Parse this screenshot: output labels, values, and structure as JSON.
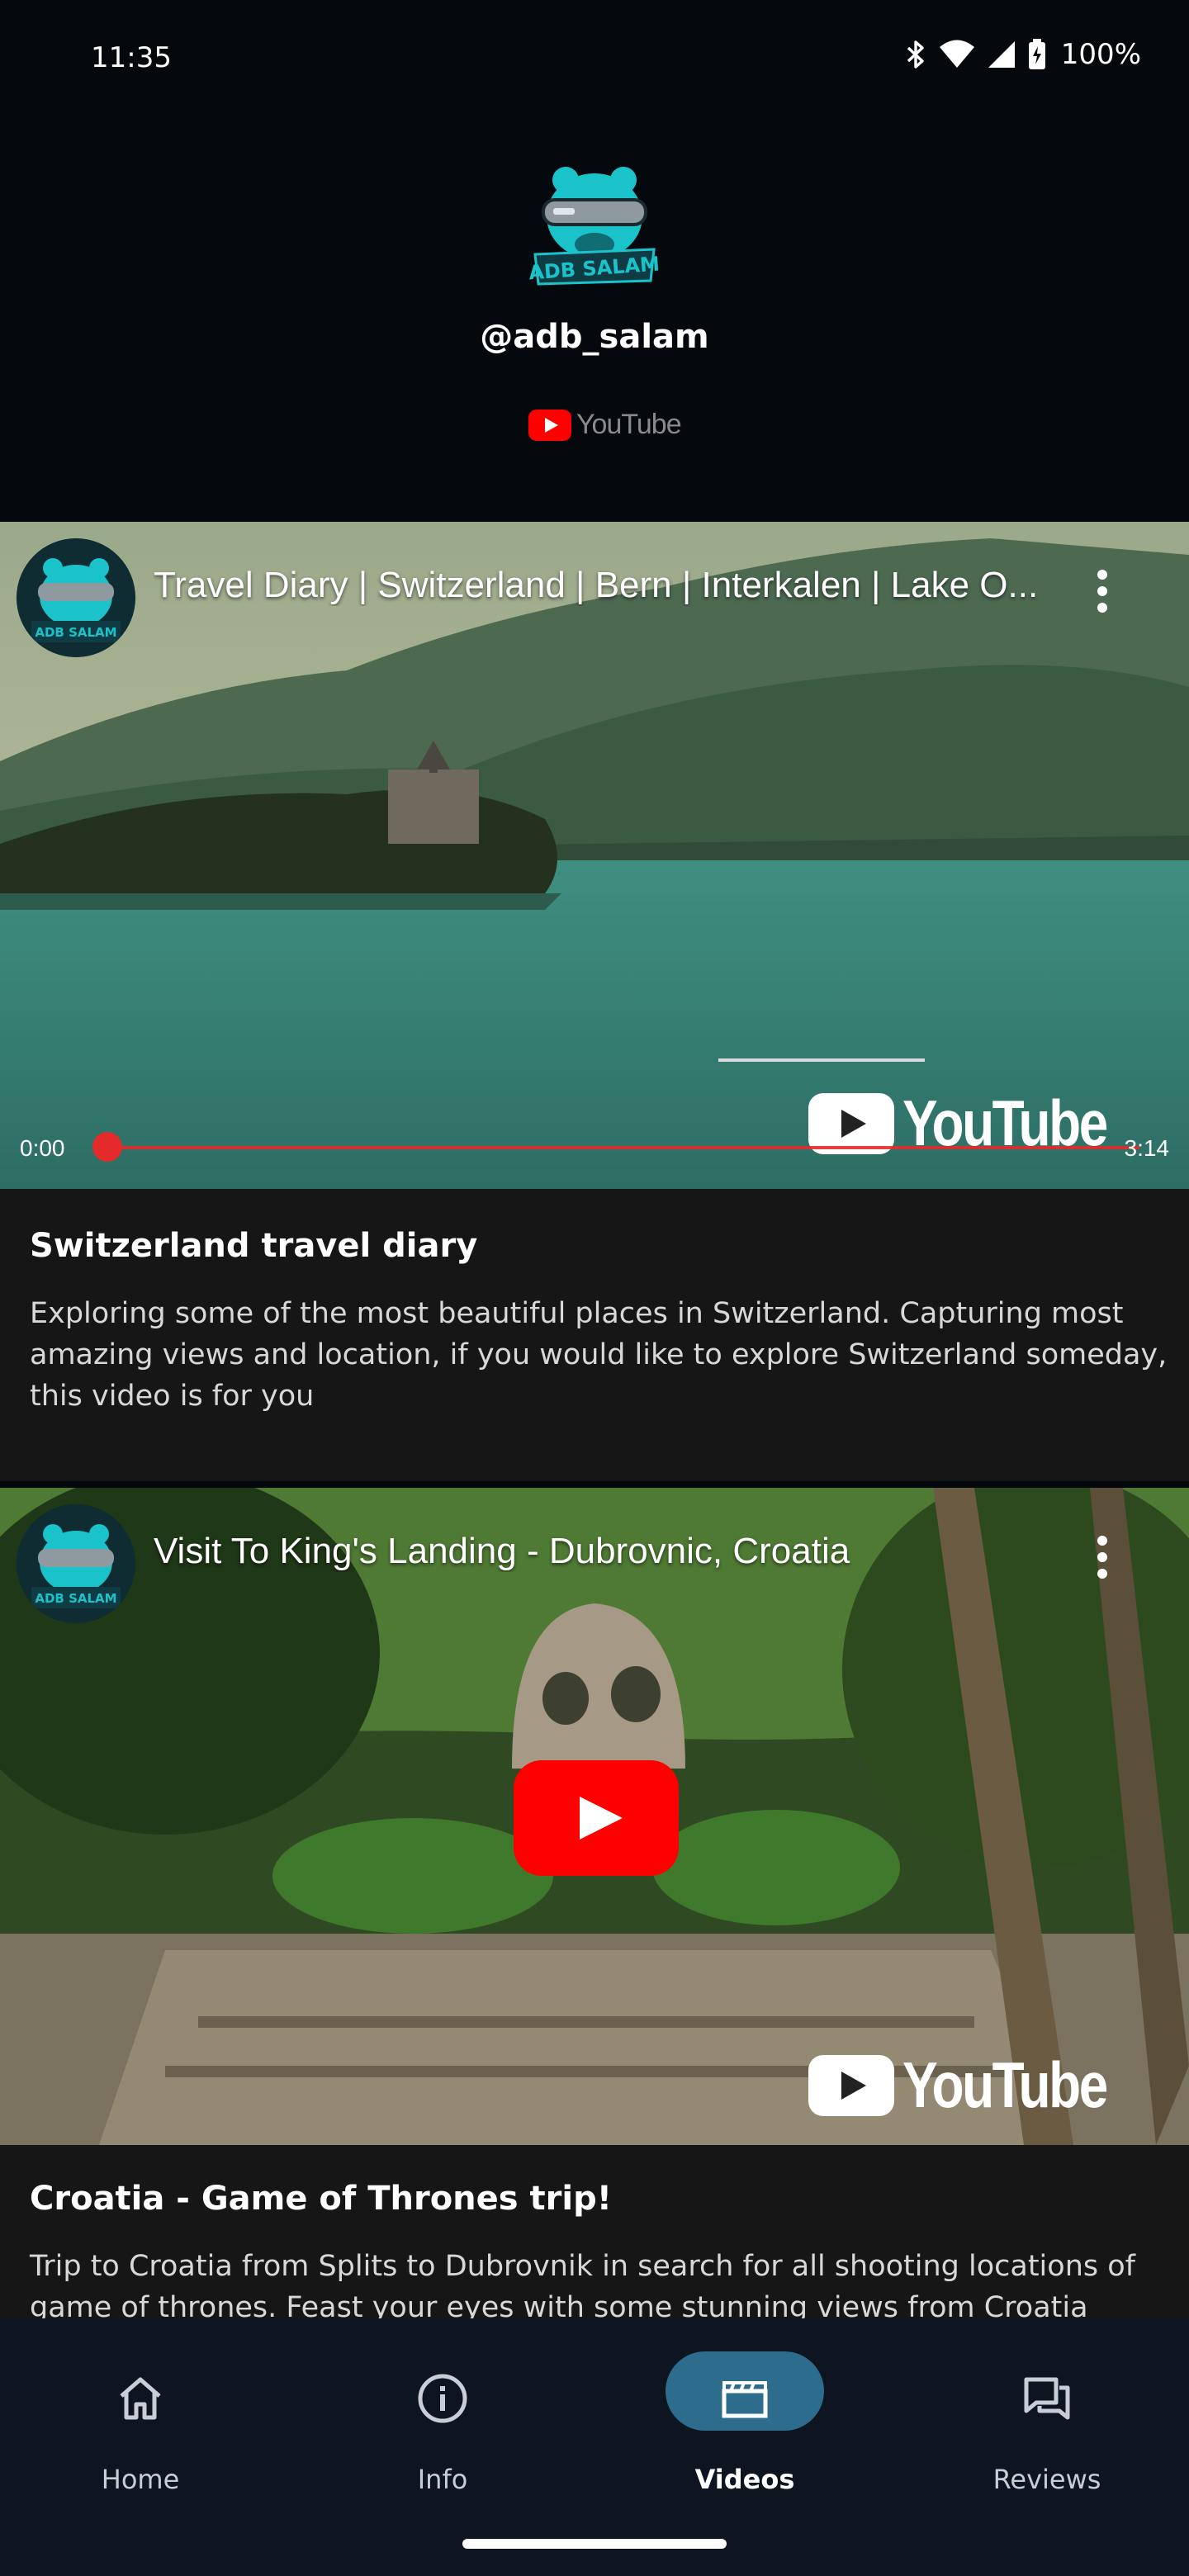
{
  "status_bar": {
    "time": "11:35",
    "battery": "100%"
  },
  "profile": {
    "handle": "@adb_salam",
    "platform": "YouTube",
    "logo_text": "ADB SALAM"
  },
  "videos": [
    {
      "title": "Travel Diary | Switzerland | Bern | Interkalen | Lake O...",
      "time_current": "0:00",
      "time_total": "3:14",
      "watermark": "YouTube",
      "card_title": "Switzerland travel diary",
      "description": "Exploring some of the most beautiful places in Switzerland. Capturing most amazing views and location, if you would like to explore Switzerland someday, this video is for you"
    },
    {
      "title": "Visit To King's Landing - Dubrovnic, Croatia",
      "watermark": "YouTube",
      "card_title": "Croatia - Game of Thrones trip!",
      "description": "Trip to Croatia from Splits to Dubrovnik in search for all shooting locations of game of thrones. Feast your eyes with some stunning views from Croatia"
    }
  ],
  "nav": [
    {
      "label": "Home",
      "icon": "home-icon"
    },
    {
      "label": "Info",
      "icon": "info-icon"
    },
    {
      "label": "Videos",
      "icon": "clapperboard-icon",
      "active": true
    },
    {
      "label": "Reviews",
      "icon": "chat-bubbles-icon"
    }
  ],
  "colors": {
    "accent": "#2e6c8e",
    "youtube_red": "#ff0000",
    "card_bg": "#161616",
    "nav_bg": "#0d1520"
  }
}
